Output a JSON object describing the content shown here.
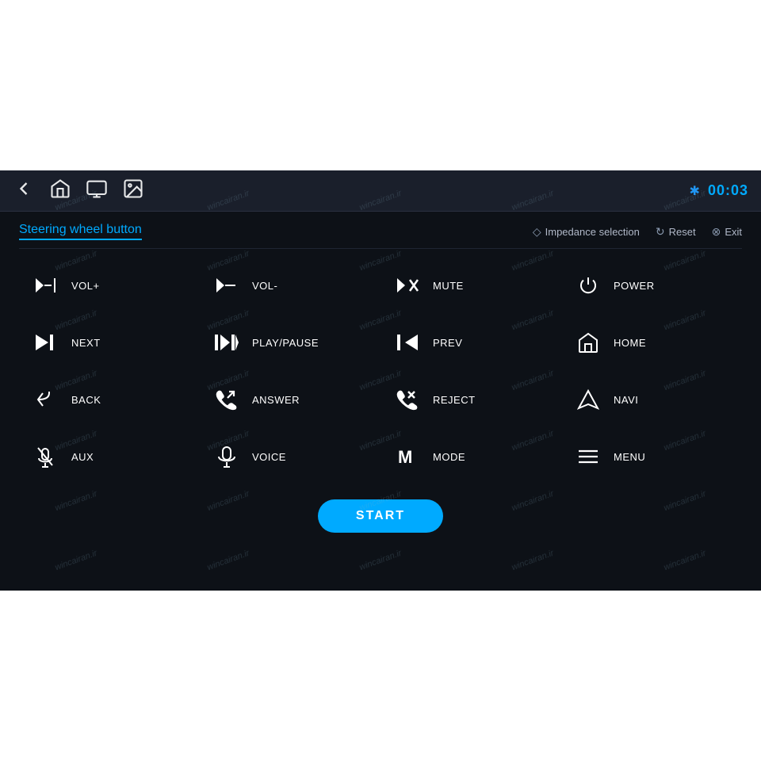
{
  "screen": {
    "nav": {
      "icons": [
        "back-icon",
        "home-icon",
        "screen-icon",
        "image-icon"
      ],
      "bluetooth_icon": "✱",
      "clock": "00:03"
    },
    "section": {
      "title": "Steering wheel button",
      "actions": [
        {
          "icon": "shield-icon",
          "label": "Impedance selection"
        },
        {
          "icon": "reset-icon",
          "label": "Reset"
        },
        {
          "icon": "exit-icon",
          "label": "Exit"
        }
      ]
    },
    "buttons": [
      {
        "id": "vol-plus",
        "icon": "vol-plus-icon",
        "label": "VOL+"
      },
      {
        "id": "vol-minus",
        "icon": "vol-minus-icon",
        "label": "VOL-"
      },
      {
        "id": "mute",
        "icon": "mute-icon",
        "label": "MUTE"
      },
      {
        "id": "power",
        "icon": "power-icon",
        "label": "POWER"
      },
      {
        "id": "next",
        "icon": "next-icon",
        "label": "NEXT"
      },
      {
        "id": "play-pause",
        "icon": "play-pause-icon",
        "label": "PLAY/PAUSE"
      },
      {
        "id": "prev",
        "icon": "prev-icon",
        "label": "PREV"
      },
      {
        "id": "home",
        "icon": "home-btn-icon",
        "label": "HOME"
      },
      {
        "id": "back",
        "icon": "back-btn-icon",
        "label": "BACK"
      },
      {
        "id": "answer",
        "icon": "answer-icon",
        "label": "ANSWER"
      },
      {
        "id": "reject",
        "icon": "reject-icon",
        "label": "REJECT"
      },
      {
        "id": "navi",
        "icon": "navi-icon",
        "label": "NAVI"
      },
      {
        "id": "aux",
        "icon": "aux-icon",
        "label": "AUX"
      },
      {
        "id": "voice",
        "icon": "voice-icon",
        "label": "VOICE"
      },
      {
        "id": "mode",
        "icon": "mode-icon",
        "label": "MODE"
      },
      {
        "id": "menu",
        "icon": "menu-icon",
        "label": "MENU"
      }
    ],
    "start_button": "START",
    "watermark_text": "wincairan.ir"
  }
}
